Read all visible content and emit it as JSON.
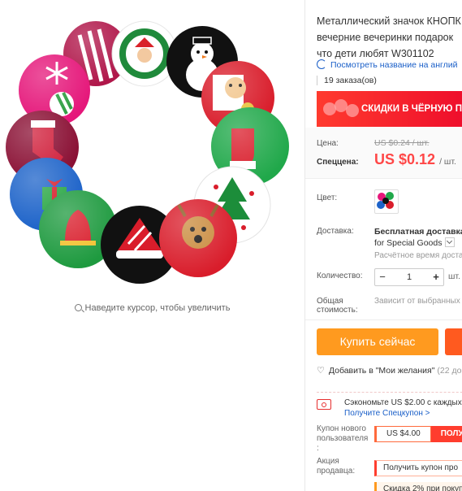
{
  "gallery": {
    "zoom_hint": "Наведите курсор, чтобы увеличить"
  },
  "product": {
    "title_lines": [
      "Металлический значок КНОПК",
      "вечерние вечеринки подарок",
      "что дети любят W301102"
    ],
    "translate_link": "Посмотреть название на англий",
    "orders": "19 заказа(ов)",
    "banner_text": "СКИДКИ В ЧЁРНУЮ П"
  },
  "price": {
    "label": "Цена:",
    "old_value": "US $0.24 / шт.",
    "special_label": "Спеццена:",
    "new_value": "US $0.12",
    "unit": "/ шт."
  },
  "options": {
    "color_label": "Цвет:",
    "shipping_label": "Доставка:",
    "shipping_free": "Бесплатная доставка",
    "shipping_method": "for Special Goods",
    "shipping_time": "Расчётное время доста",
    "quantity_label": "Количество:",
    "quantity_value": "1",
    "quantity_unit": "шт.",
    "total_label": [
      "Общая",
      "стоимость:"
    ],
    "total_value": "Зависит от выбранных"
  },
  "actions": {
    "buy_now": "Купить сейчас",
    "wishlist": "Добавить в \"Мои желания\"",
    "wishlist_count": "(22 до"
  },
  "promo": {
    "save_text": "Сэкономьте US $2.00 с каждых",
    "coupon_link": "Получите Спецкупон >",
    "new_user_label": [
      "Купон нового",
      "пользователя",
      ":"
    ],
    "coupon_amount": "US $4.00",
    "coupon_get": "ПОЛУ",
    "seller_label": [
      "Акция",
      "продавца:"
    ],
    "seller_coupon": "Получить купон про",
    "discount": "Скидка 2% при покуп"
  },
  "colors": {
    "price_red": "#ff4747",
    "buy_orange": "#ff9a1f",
    "link_blue": "#1a5fc8",
    "banner_red": "#e9002b"
  }
}
